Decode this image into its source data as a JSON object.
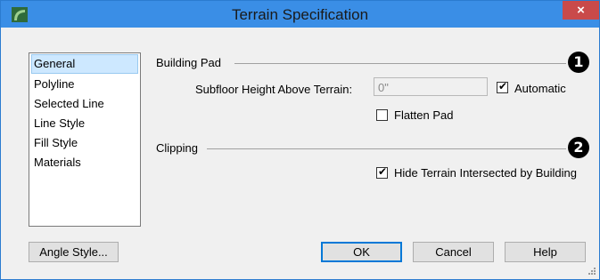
{
  "window": {
    "title": "Terrain Specification",
    "close_glyph": "×"
  },
  "sidebar": {
    "items": [
      {
        "label": "General",
        "selected": true
      },
      {
        "label": "Polyline",
        "selected": false
      },
      {
        "label": "Selected Line",
        "selected": false
      },
      {
        "label": "Line Style",
        "selected": false
      },
      {
        "label": "Fill Style",
        "selected": false
      },
      {
        "label": "Materials",
        "selected": false
      }
    ]
  },
  "building_pad": {
    "title": "Building Pad",
    "marker": "1",
    "subfloor_label": "Subfloor Height Above Terrain:",
    "subfloor_value": "0\"",
    "automatic_label": "Automatic",
    "automatic_checked": true,
    "flatten_label": "Flatten Pad",
    "flatten_checked": false
  },
  "clipping": {
    "title": "Clipping",
    "marker": "2",
    "hide_label": "Hide Terrain Intersected by Building",
    "hide_checked": true
  },
  "buttons": {
    "angle_style": "Angle Style...",
    "ok": "OK",
    "cancel": "Cancel",
    "help": "Help"
  },
  "colors": {
    "titlebar": "#3a8ee6",
    "close": "#c94a4a",
    "selection": "#cde8ff",
    "dialog_bg": "#f0f0f0"
  }
}
